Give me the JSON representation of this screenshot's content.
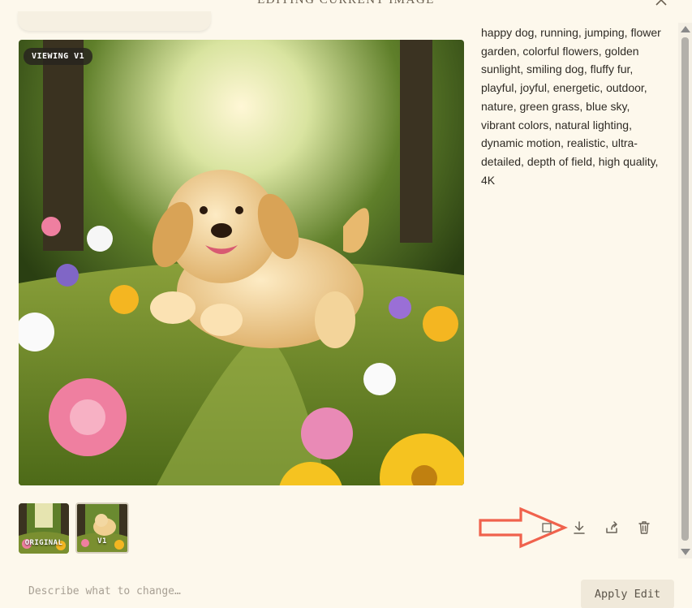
{
  "header": {
    "title": "EDITING CURRENT IMAGE",
    "close_icon": "close-icon"
  },
  "image": {
    "badge": "VIEWING V1",
    "subject": "golden retriever puppy jumping in flower garden"
  },
  "prompt": {
    "text": "happy dog, running, jumping, flower garden, colorful flowers, golden sunlight, smiling dog, fluffy fur, playful, joyful, energetic, outdoor, nature, green grass, blue sky, vibrant colors, natural lighting, dynamic motion, realistic, ultra-detailed, depth of field, high quality, 4K"
  },
  "versions": [
    {
      "label": "ORIGINAL"
    },
    {
      "label": "V1"
    }
  ],
  "actions": {
    "items": [
      {
        "name": "download-icon"
      },
      {
        "name": "share-icon"
      },
      {
        "name": "trash-icon"
      }
    ],
    "annotation_color": "#f0624d"
  },
  "edit": {
    "placeholder": "Describe what to change…",
    "apply_label": "Apply Edit"
  },
  "colors": {
    "background": "#fdf8ec",
    "accent": "#f0624d"
  }
}
